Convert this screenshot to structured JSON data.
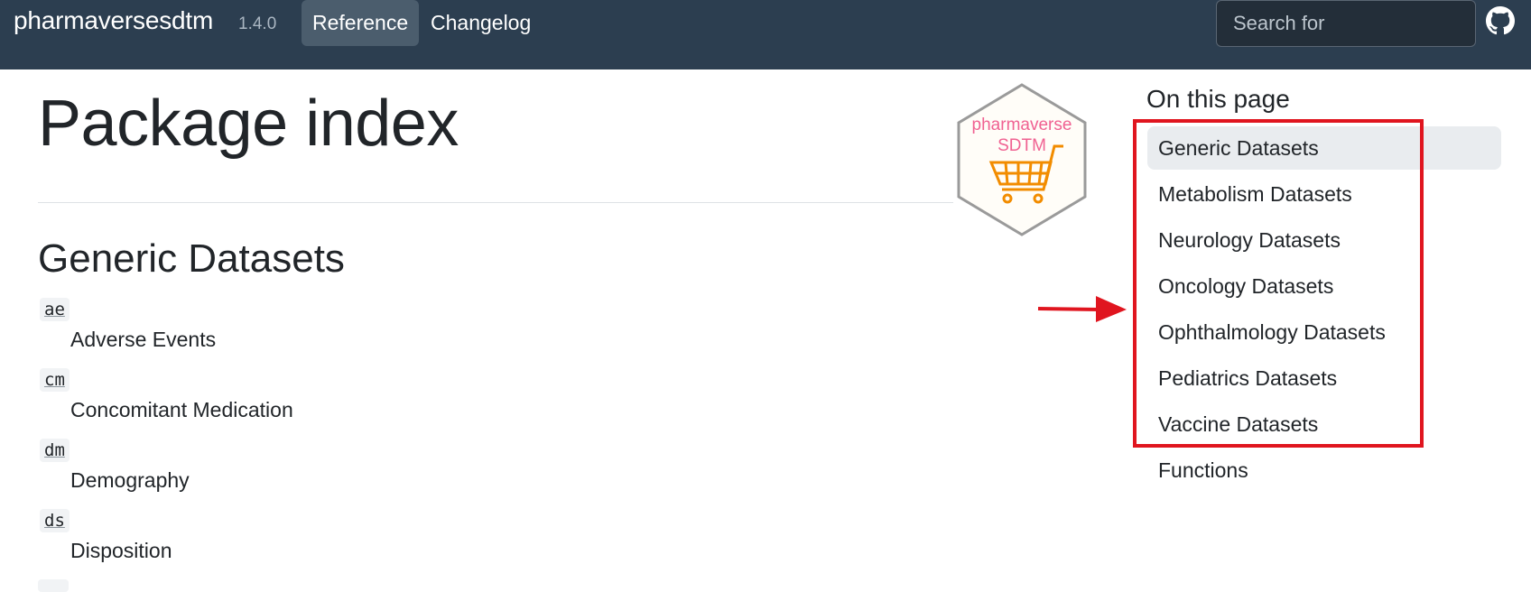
{
  "navbar": {
    "brand": "pharmaversesdtm",
    "version": "1.4.0",
    "links": [
      "Reference",
      "Changelog"
    ],
    "search_placeholder": "Search for",
    "github_icon": "github-icon"
  },
  "main": {
    "title": "Package index",
    "logo_text_line1": "pharmaverse",
    "logo_text_line2": "SDTM",
    "section_title": "Generic Datasets",
    "items": [
      {
        "code": "ae",
        "desc": "Adverse Events"
      },
      {
        "code": "cm",
        "desc": "Concomitant Medication"
      },
      {
        "code": "dm",
        "desc": "Demography"
      },
      {
        "code": "ds",
        "desc": "Disposition"
      }
    ]
  },
  "toc": {
    "title": "On this page",
    "items": [
      "Generic Datasets",
      "Metabolism Datasets",
      "Neurology Datasets",
      "Oncology Datasets",
      "Ophthalmology Datasets",
      "Pediatrics Datasets",
      "Vaccine Datasets",
      "Functions"
    ]
  },
  "colors": {
    "navbar_bg": "#2c3e50",
    "highlight": "#e0151f",
    "logo_pink": "#f06292",
    "logo_orange": "#f28c00"
  }
}
